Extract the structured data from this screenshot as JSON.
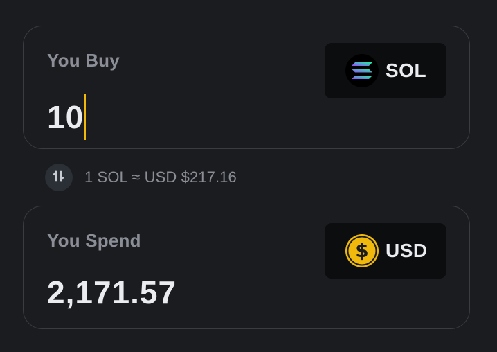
{
  "buy": {
    "label": "You Buy",
    "amount": "10",
    "token": {
      "symbol": "SOL",
      "icon": "solana-logo-icon"
    }
  },
  "rate": {
    "text": "1 SOL ≈ USD $217.16",
    "swap_icon": "swap-arrows-icon"
  },
  "spend": {
    "label": "You Spend",
    "amount": "2,171.57",
    "token": {
      "symbol": "USD",
      "icon": "dollar-coin-icon"
    }
  },
  "colors": {
    "background": "#1b1c20",
    "card_border": "#3a3c42",
    "label": "#8b8e96",
    "amount": "#eaecef",
    "caret": "#f0b90b",
    "token_button_bg": "#0c0d0f",
    "usd_coin": "#f0b90b"
  }
}
